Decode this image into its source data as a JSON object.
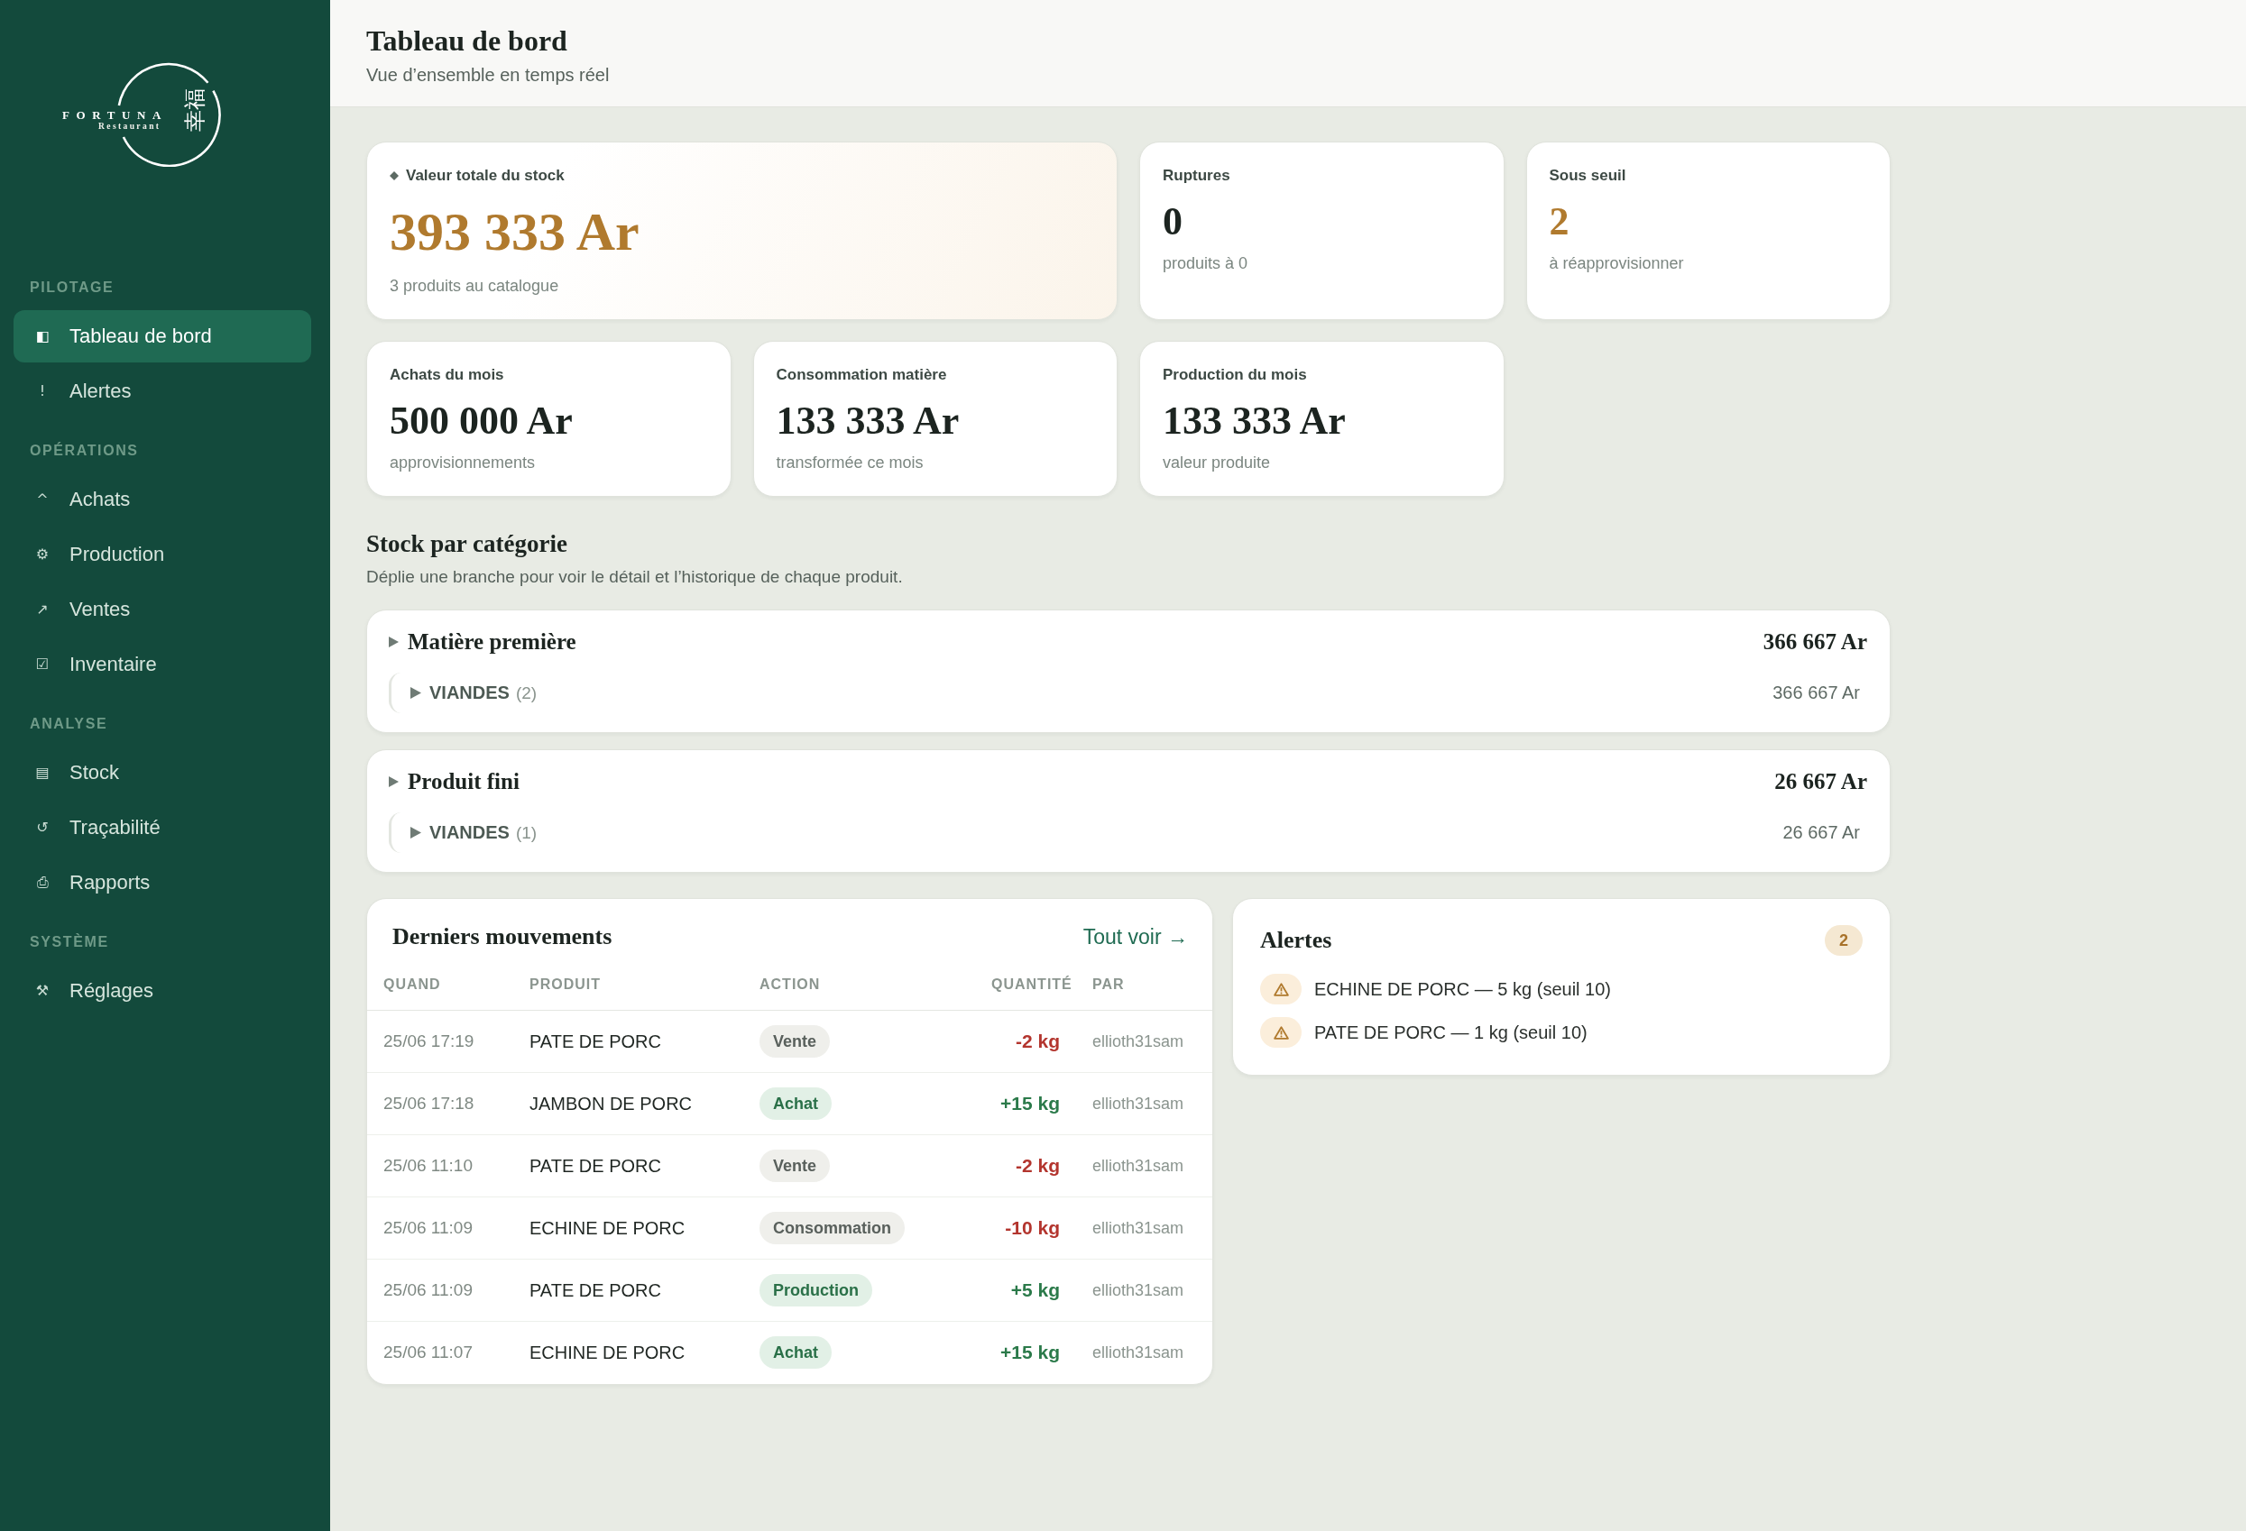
{
  "sidebar": {
    "logo": {
      "name": "FORTUNA",
      "tagline": "Restaurant",
      "emblem": "幸福"
    },
    "sections": [
      {
        "title": "PILOTAGE",
        "items": [
          {
            "icon": "◧",
            "label": "Tableau de bord",
            "selected": true
          },
          {
            "icon": "!",
            "label": "Alertes",
            "selected": false
          }
        ]
      },
      {
        "title": "OPÉRATIONS",
        "items": [
          {
            "icon": "^",
            "label": "Achats",
            "selected": false
          },
          {
            "icon": "⚙",
            "label": "Production",
            "selected": false
          },
          {
            "icon": "↗",
            "label": "Ventes",
            "selected": false
          },
          {
            "icon": "☑",
            "label": "Inventaire",
            "selected": false
          }
        ]
      },
      {
        "title": "ANALYSE",
        "items": [
          {
            "icon": "▤",
            "label": "Stock",
            "selected": false
          },
          {
            "icon": "↺",
            "label": "Traçabilité",
            "selected": false
          },
          {
            "icon": "⎙",
            "label": "Rapports",
            "selected": false
          }
        ]
      },
      {
        "title": "SYSTÈME",
        "items": [
          {
            "icon": "⚒",
            "label": "Réglages",
            "selected": false
          }
        ]
      }
    ]
  },
  "header": {
    "title": "Tableau de bord",
    "subtitle": "Vue d’ensemble en temps réel"
  },
  "stats": [
    {
      "kind": "featured",
      "label": "Valeur totale du stock",
      "value": "393 333 Ar",
      "note": "3 produits au catalogue"
    },
    {
      "kind": "plain",
      "label": "Ruptures",
      "value": "0",
      "note": "produits à 0"
    },
    {
      "kind": "warning",
      "label": "Sous seuil",
      "value": "2",
      "note": "à réapprovisionner"
    },
    {
      "kind": "plain",
      "label": "Achats du mois",
      "value": "500 000 Ar",
      "note": "approvisionnements"
    },
    {
      "kind": "plain",
      "label": "Consommation matière",
      "value": "133 333 Ar",
      "note": "transformée ce mois"
    },
    {
      "kind": "plain",
      "label": "Production du mois",
      "value": "133 333 Ar",
      "note": "valeur produite"
    }
  ],
  "stock": {
    "title": "Stock par catégorie",
    "subtitle": "Déplie une branche pour voir le détail et l’historique de chaque produit.",
    "categories": [
      {
        "name": "Matière première",
        "total": "366 667 Ar",
        "children": [
          {
            "name": "VIANDES",
            "count": "(2)",
            "total": "366 667 Ar"
          }
        ]
      },
      {
        "name": "Produit fini",
        "total": "26 667 Ar",
        "children": [
          {
            "name": "VIANDES",
            "count": "(1)",
            "total": "26 667 Ar"
          }
        ]
      }
    ]
  },
  "movements": {
    "title": "Derniers mouvements",
    "link": "Tout voir →",
    "columns": [
      "QUAND",
      "PRODUIT",
      "ACTION",
      "QUANTITÉ",
      "PAR"
    ],
    "rows": [
      {
        "when": "25/06 17:19",
        "product": "PATE DE PORC",
        "action": "Vente",
        "kind": "sale",
        "quantity": "-2 kg",
        "by": "ellioth31sam"
      },
      {
        "when": "25/06 17:18",
        "product": "JAMBON DE PORC",
        "action": "Achat",
        "kind": "purchase",
        "quantity": "+15 kg",
        "by": "ellioth31sam"
      },
      {
        "when": "25/06 11:10",
        "product": "PATE DE PORC",
        "action": "Vente",
        "kind": "sale",
        "quantity": "-2 kg",
        "by": "ellioth31sam"
      },
      {
        "when": "25/06 11:09",
        "product": "ECHINE DE PORC",
        "action": "Consommation",
        "kind": "consumption",
        "quantity": "-10 kg",
        "by": "ellioth31sam"
      },
      {
        "when": "25/06 11:09",
        "product": "PATE DE PORC",
        "action": "Production",
        "kind": "production",
        "quantity": "+5 kg",
        "by": "ellioth31sam"
      },
      {
        "when": "25/06 11:07",
        "product": "ECHINE DE PORC",
        "action": "Achat",
        "kind": "purchase",
        "quantity": "+15 kg",
        "by": "ellioth31sam"
      }
    ]
  },
  "alerts": {
    "title": "Alertes",
    "count": "2",
    "items": [
      "ECHINE DE PORC — 5 kg (seuil 10)",
      "PATE DE PORC — 1 kg (seuil 10)"
    ]
  }
}
